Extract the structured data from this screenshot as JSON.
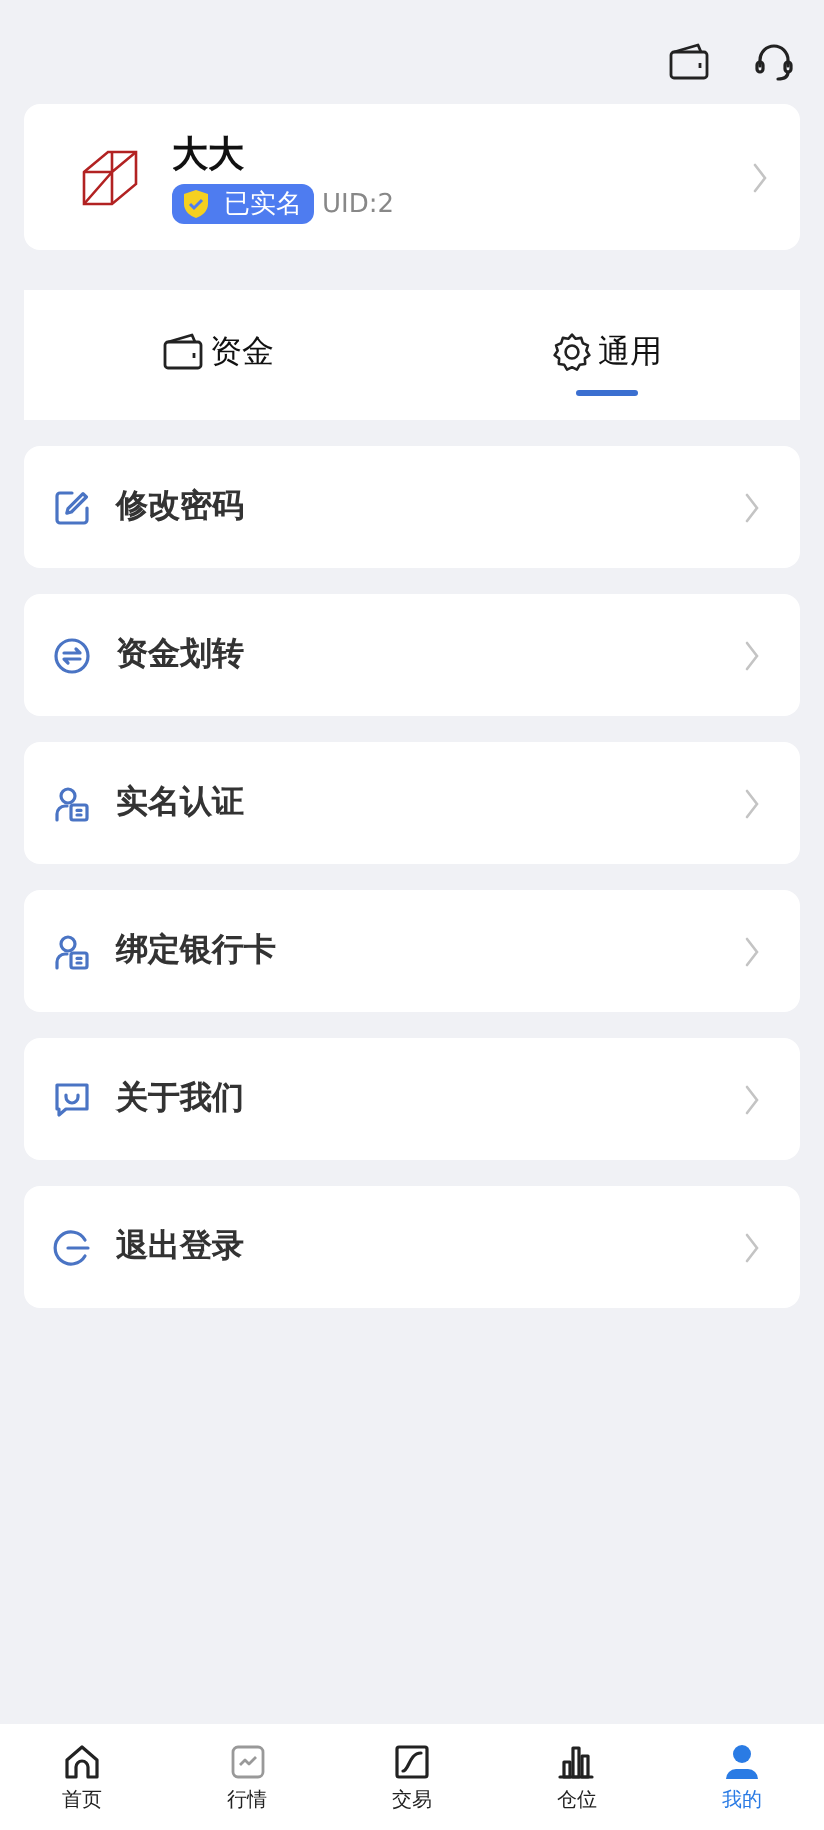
{
  "profile": {
    "name": "大大",
    "verified_badge": "已实名",
    "uid": "UID:2"
  },
  "tabs": [
    {
      "label": "资金",
      "kind": "wallet",
      "selected": false
    },
    {
      "label": "通用",
      "kind": "gear",
      "selected": true
    }
  ],
  "menu": [
    {
      "label": "修改密码",
      "kind": "edit"
    },
    {
      "label": "资金划转",
      "kind": "transfer"
    },
    {
      "label": "实名认证",
      "kind": "id"
    },
    {
      "label": "绑定银行卡",
      "kind": "id"
    },
    {
      "label": "关于我们",
      "kind": "chat"
    },
    {
      "label": "退出登录",
      "kind": "logout"
    }
  ],
  "bottom_nav": [
    {
      "label": "首页",
      "kind": "home",
      "selected": false
    },
    {
      "label": "行情",
      "kind": "market",
      "selected": false
    },
    {
      "label": "交易",
      "kind": "trade",
      "selected": false
    },
    {
      "label": "仓位",
      "kind": "position",
      "selected": false
    },
    {
      "label": "我的",
      "kind": "user",
      "selected": true
    }
  ]
}
